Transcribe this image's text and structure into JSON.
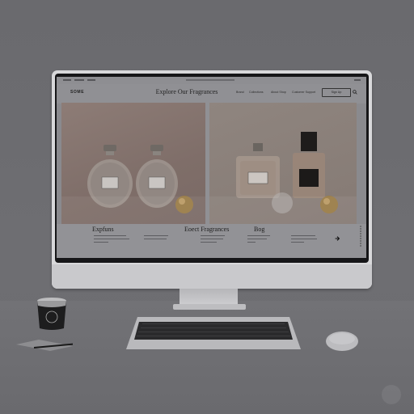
{
  "browser": {
    "tabs": [
      "",
      "",
      "",
      ""
    ]
  },
  "header": {
    "logo": "SOME",
    "title": "Explore Our Fragrances",
    "nav": [
      "Brand",
      "Collections",
      "About Shop",
      "Customer Support"
    ],
    "signup_label": "Sign Up"
  },
  "hero": {
    "left_panel": "perfume-pair",
    "right_panel": "perfume-trio"
  },
  "cards": [
    {
      "title": "Expfuns"
    },
    {
      "title": "Eoect Fragrances"
    },
    {
      "title": "Bog"
    }
  ],
  "cup": {
    "logo_text": "CUP CO."
  },
  "colors": {
    "screen_bg": "#909094",
    "panel_left": "#8d7c76",
    "panel_right": "#8f857f",
    "accent_gold": "#a88448"
  }
}
